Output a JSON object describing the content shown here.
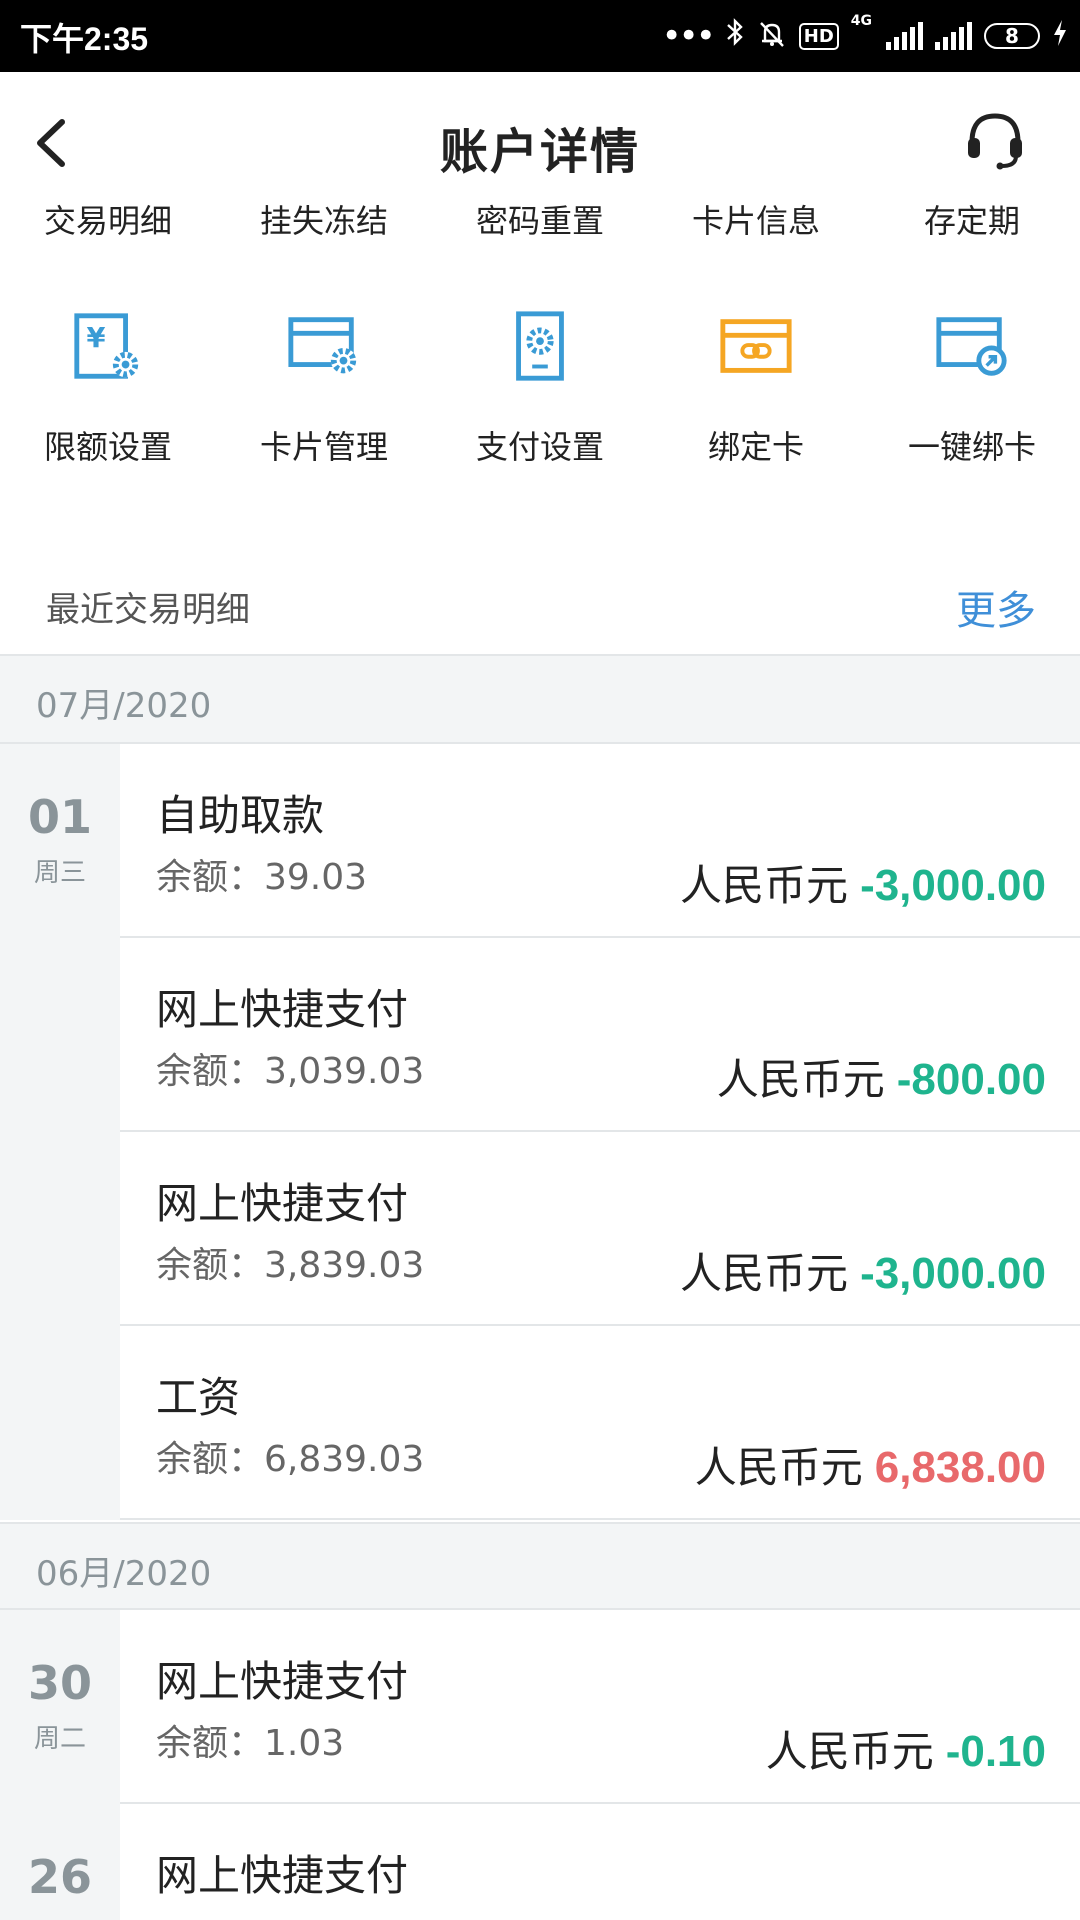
{
  "status_bar": {
    "time": "下午2:35",
    "network": "4G",
    "hd_label": "HD",
    "battery": "8"
  },
  "header": {
    "title": "账户详情",
    "back_icon": "chevron-left-icon",
    "support_icon": "headset-icon"
  },
  "tabs": [
    "交易明细",
    "挂失冻结",
    "密码重置",
    "卡片信息",
    "存定期"
  ],
  "services": [
    {
      "label": "限额设置",
      "icon": "limit-settings-icon",
      "color": "#3a9bd5"
    },
    {
      "label": "卡片管理",
      "icon": "card-manage-icon",
      "color": "#3a9bd5"
    },
    {
      "label": "支付设置",
      "icon": "payment-settings-icon",
      "color": "#3a9bd5"
    },
    {
      "label": "绑定卡",
      "icon": "bind-card-icon",
      "color": "#f5a623"
    },
    {
      "label": "一键绑卡",
      "icon": "quick-bind-icon",
      "color": "#3a9bd5"
    }
  ],
  "recent": {
    "title": "最近交易明细",
    "more": "更多"
  },
  "months": [
    {
      "label": "07月/2020",
      "days": [
        {
          "day": "01",
          "weekday": "周三",
          "transactions": [
            {
              "name": "自助取款",
              "balance": "余额：39.03",
              "currency": "人民币元",
              "amount": "-3,000.00",
              "sign": "neg"
            },
            {
              "name": "网上快捷支付",
              "balance": "余额：3,039.03",
              "currency": "人民币元",
              "amount": "-800.00",
              "sign": "neg"
            },
            {
              "name": "网上快捷支付",
              "balance": "余额：3,839.03",
              "currency": "人民币元",
              "amount": "-3,000.00",
              "sign": "neg"
            },
            {
              "name": "工资",
              "balance": "余额：6,839.03",
              "currency": "人民币元",
              "amount": "6,838.00",
              "sign": "pos"
            }
          ]
        }
      ]
    },
    {
      "label": "06月/2020",
      "days": [
        {
          "day": "30",
          "weekday": "周二",
          "transactions": [
            {
              "name": "网上快捷支付",
              "balance": "余额：1.03",
              "currency": "人民币元",
              "amount": "-0.10",
              "sign": "neg"
            }
          ]
        },
        {
          "day": "26",
          "weekday": "",
          "transactions": [
            {
              "name": "网上快捷支付",
              "balance": "",
              "currency": "",
              "amount": "",
              "sign": "neg"
            }
          ]
        }
      ]
    }
  ],
  "colors": {
    "accent": "#3f8fd8",
    "negative": "#1fb48e",
    "positive": "#e8696b"
  }
}
